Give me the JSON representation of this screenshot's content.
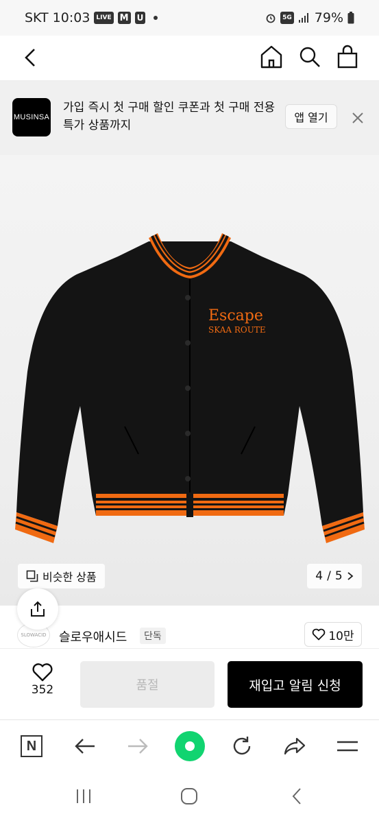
{
  "status": {
    "carrier": "SKT",
    "time": "10:03",
    "badges": [
      "LIVE",
      "M",
      "U"
    ],
    "network": "5G",
    "battery": "79%"
  },
  "icons": {
    "back": "chevron-left-icon",
    "home": "home-icon",
    "search": "search-icon",
    "cart": "shopping-bag-icon"
  },
  "banner": {
    "logo_text": "MUSINSA",
    "message": "가입 즉시 첫 구매 할인 쿠폰과 첫 구매 전용 특가 상품까지",
    "open_app": "앱 열기"
  },
  "product_image": {
    "embroidery_line1": "Escape",
    "embroidery_line2": "SKAA ROUTE",
    "similar_label": "비슷한 상품",
    "page_current": "4",
    "page_total": "5",
    "accent_color": "#f06a12"
  },
  "brand": {
    "logo_text": "SLOWACID",
    "name": "슬로우애시드",
    "badge": "단독",
    "likes": "10만"
  },
  "purchase": {
    "wish_count": "352",
    "sold_out": "품절",
    "restock": "재입고 알림 신청"
  },
  "browser": {
    "n_label": "N",
    "green_color": "#11d470"
  }
}
